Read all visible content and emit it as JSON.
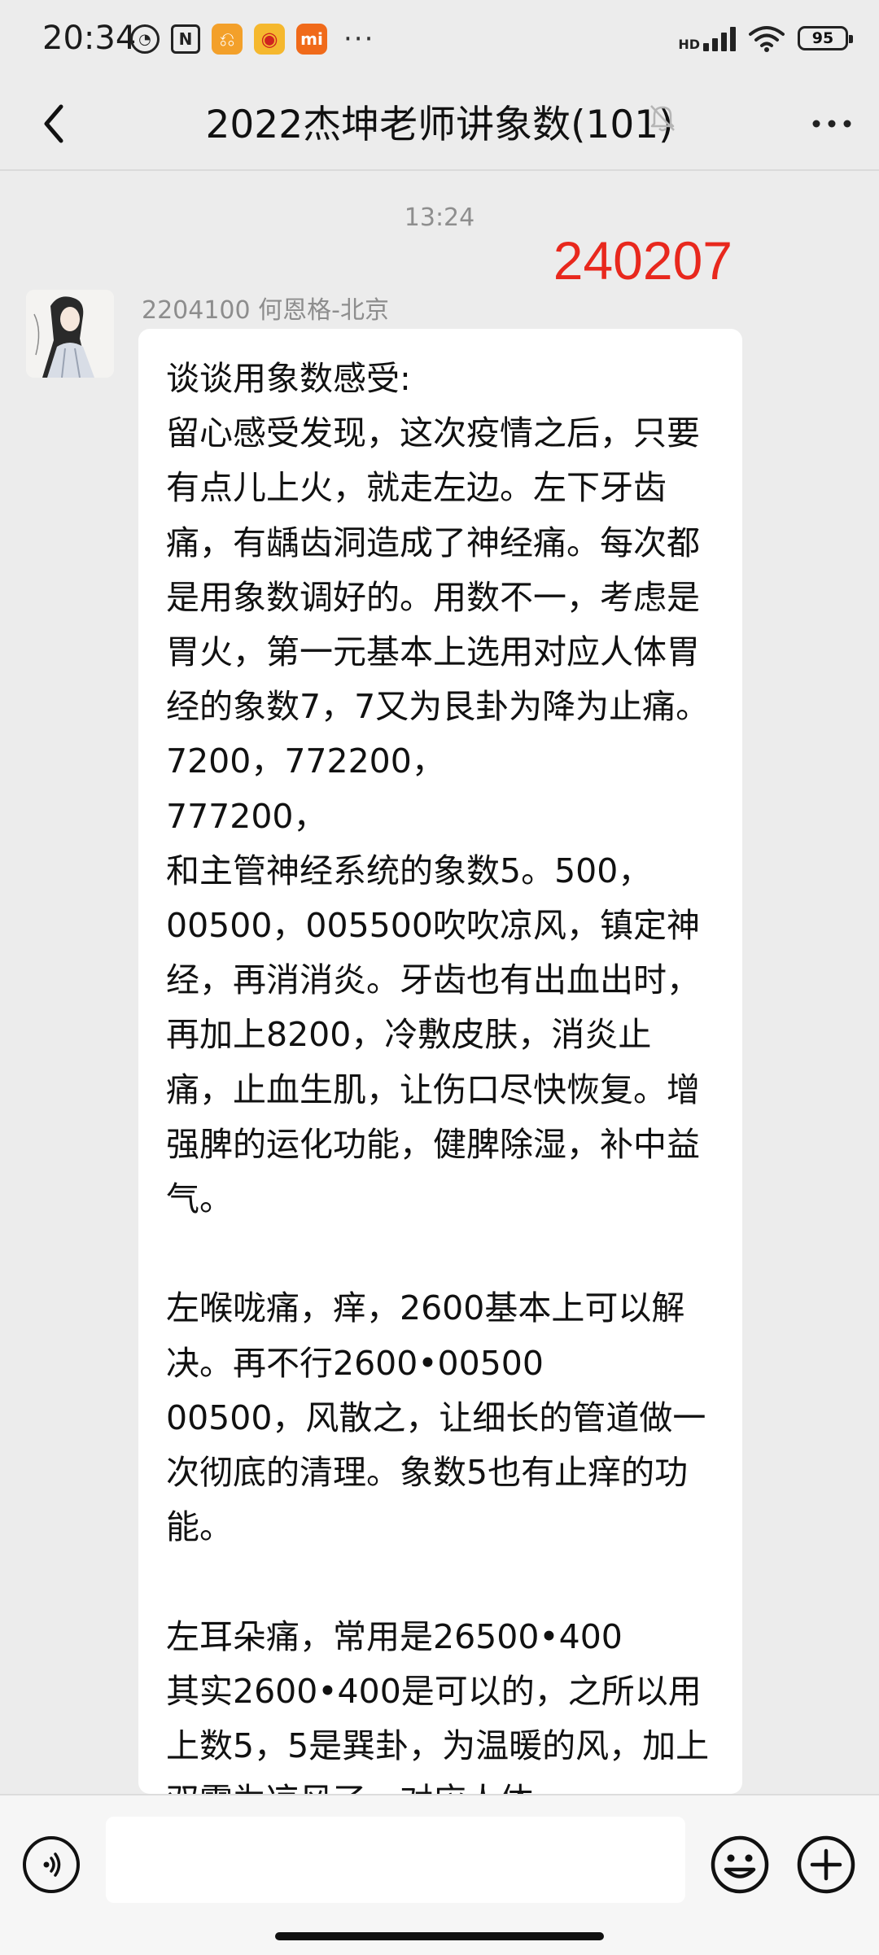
{
  "status_bar": {
    "time": "20:34",
    "battery": "95",
    "network": "HD",
    "more": "···"
  },
  "nav": {
    "title": "2022杰坤老师讲象数(101)"
  },
  "chat": {
    "timestamp": "13:24",
    "overlay_number": "240207",
    "message": {
      "sender": "2204100 何恩格-北京",
      "paragraphs": [
        "谈谈用象数感受:\n留心感受发现，这次疫情之后，只要有点儿上火，就走左边。左下牙齿痛，有龋齿洞造成了神经痛。每次都是用象数调好的。用数不一，考虑是胃火，第一元基本上选用对应人体胃经的象数7，7又为艮卦为降为止痛。7200，772200，\n777200，\n和主管神经系统的象数5。500，00500，005500吹吹凉风，镇定神经，再消消炎。牙齿也有出血出时，再加上8200，冷敷皮肤，消炎止痛，止血生肌，让伤口尽快恢复。增强脾的运化功能，健脾除湿，补中益气。",
        "左喉咙痛，痒，2600基本上可以解决。再不行2600•00500\n00500，风散之，让细长的管道做一次彻底的清理。象数5也有止痒的功能。",
        "左耳朵痛，常用是26500•400\n其实2600•400是可以的，之所以用上数5，5是巽卦，为温暖的风，加上双零为凉风了，对应人体"
      ]
    }
  },
  "input_bar": {
    "placeholder": ""
  },
  "colors": {
    "background": "#ececec",
    "bubble": "#ffffff",
    "overlay_number": "#e8281d",
    "muted_text": "#8d8d8d"
  },
  "icons": [
    "back-arrow-icon",
    "mute-bell-icon",
    "more-icon",
    "voice-icon",
    "emoji-icon",
    "plus-icon",
    "alarm-icon",
    "nfc-icon",
    "weibo-icon",
    "mi-icon",
    "signal-icon",
    "wifi-icon",
    "battery-icon"
  ]
}
